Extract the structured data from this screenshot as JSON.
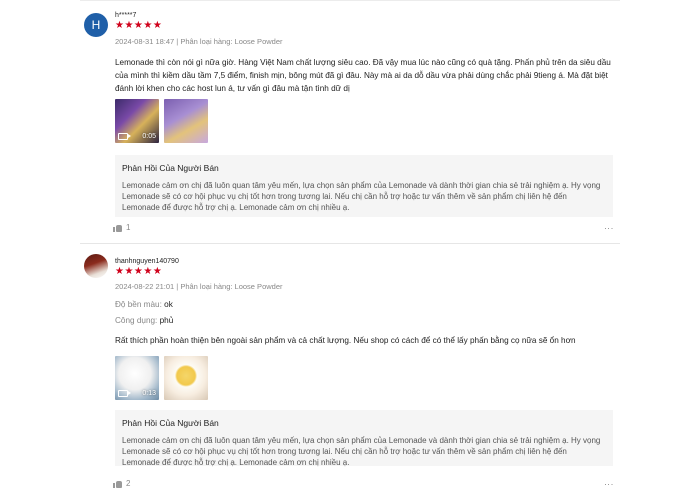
{
  "reviews": [
    {
      "avatar_letter": "H",
      "username": "h*****7",
      "stars": "★★★★★",
      "meta": "2024-08-31 18:47 | Phân loại hàng: Loose Powder",
      "text": "Lemonade thì còn nói gì nữa giờ. Hàng Việt Nam chất lượng siêu cao. Đã vậy mua lúc nào cũng có quà tặng. Phấn phủ trên da siêu dầu của mình thì kiềm dầu tầm 7,5 điểm, finish mịn, bông mút đã gì đâu. Này mà ai da dỗ dầu vừa phải dùng chắc phải 9tieng á. Mà đặt biệt đánh lời khen cho các host lun á, tư vấn gì đâu mà tận tình dữ dị",
      "video_duration": "0:05",
      "reply_title": "Phản Hồi Của Người Bán",
      "reply_text": "Lemonade cảm ơn chị đã luôn quan tâm yêu mến, lựa chọn sản phẩm của Lemonade và dành thời gian chia sẻ trải nghiệm ạ. Hy vọng Lemonade sẽ có cơ hội phục vụ chị tốt hơn trong tương lai. Nếu chị cần hỗ trợ hoặc tư vấn thêm về sản phẩm chị liên hệ đến Lemonade để được hỗ trợ chị ạ. Lemonade cảm ơn chị nhiều ạ.",
      "likes": "1",
      "more": "⋮"
    },
    {
      "username": "thanhnguyen140790",
      "stars": "★★★★★",
      "meta": "2024-08-22 21:01 | Phân loại hàng: Loose Powder",
      "attr1_label": "Độ bền màu:",
      "attr1_value": "ok",
      "attr2_label": "Công dụng:",
      "attr2_value": "phủ",
      "text": "Rất thích phần hoàn thiện bên ngoài sản phẩm và cả chất lượng. Nếu shop có cách để có thể lấy phấn bằng cọ nữa sẽ ổn hơn",
      "video_duration": "0:13",
      "reply_title": "Phản Hồi Của Người Bán",
      "reply_text": "Lemonade cảm ơn chị đã luôn quan tâm yêu mến, lựa chọn sản phẩm của Lemonade và dành thời gian chia sẻ trải nghiệm ạ. Hy vọng Lemonade sẽ có cơ hội phục vụ chị tốt hơn trong tương lai. Nếu chị cần hỗ trợ hoặc tư vấn thêm về sản phẩm chị liên hệ đến Lemonade để được hỗ trợ chị ạ. Lemonade cảm ơn chị nhiều ạ.",
      "likes": "2",
      "more": "⋮"
    }
  ],
  "colors": {
    "star": "#d0011b",
    "avatar_h": "#1f5fa8",
    "reply_bg": "#f5f5f5"
  },
  "icons": [
    "video-camera-icon",
    "thumbs-up-icon",
    "more-options-icon"
  ]
}
